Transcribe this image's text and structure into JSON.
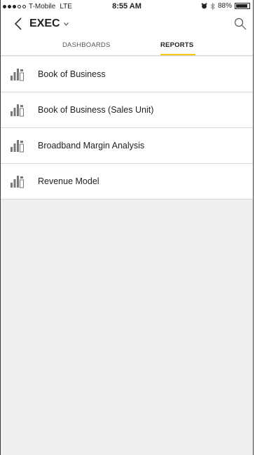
{
  "status_bar": {
    "carrier": "T-Mobile",
    "network": "LTE",
    "time": "8:55 AM",
    "battery": "88%",
    "battery_level": 0.88
  },
  "nav": {
    "title": "EXEC",
    "back_icon": "chevron-left-icon",
    "search_icon": "search-icon",
    "dropdown_icon": "chevron-down-icon"
  },
  "tabs": [
    {
      "label": "DASHBOARDS",
      "active": false
    },
    {
      "label": "REPORTS",
      "active": true
    }
  ],
  "colors": {
    "accent": "#f2c811",
    "background": "#efefef"
  },
  "reports": [
    {
      "label": "Book of Business",
      "icon": "report-icon"
    },
    {
      "label": "Book of Business (Sales Unit)",
      "icon": "report-icon"
    },
    {
      "label": "Broadband Margin Analysis",
      "icon": "report-icon"
    },
    {
      "label": "Revenue Model",
      "icon": "report-icon"
    }
  ]
}
